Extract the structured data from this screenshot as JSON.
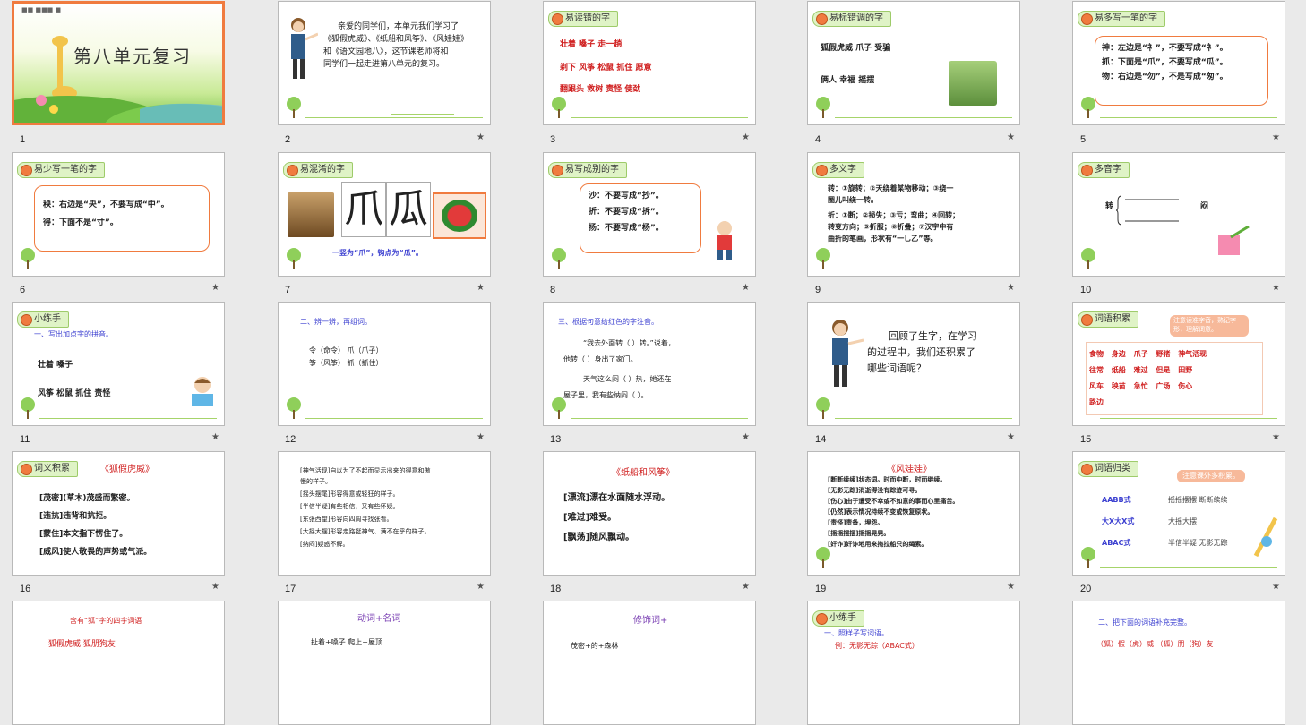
{
  "slides": [
    {
      "num": "1",
      "title": "第八单元复习",
      "header": "■■  ■■■  ■"
    },
    {
      "num": "2",
      "lines": [
        "亲爱的同学们，本单元我们学习了",
        "《狐假虎威》、《纸船和风筝》、《风娃娃》",
        "和《语文园地八》，这节课老师将和",
        "同学们一起走进第八单元的复习。"
      ]
    },
    {
      "num": "3",
      "tag": "易读错的字",
      "lines": [
        "壮着   嗓子   走一趟",
        "剃下   风筝   松鼠   抓住   愿意",
        "翻跟头   救树   责怪   使劲"
      ]
    },
    {
      "num": "4",
      "tag": "易标错调的字",
      "lines": [
        "狐假虎威   爪子   受骗",
        "俩人   幸福   摇摆"
      ]
    },
    {
      "num": "5",
      "tag": "易多写一笔的字",
      "lines": [
        "神：左边是“礻”，不要写成“衤”。",
        "抓：下面是“爪”，不要写成“瓜”。",
        "物：右边是“勿”，不是写成“匆”。"
      ]
    },
    {
      "num": "6",
      "tag": "易少写一笔的字",
      "lines": [
        "秧：右边是“央”，不要写成“中”。",
        "得：下面不是“寸”。"
      ]
    },
    {
      "num": "7",
      "tag": "易混淆的字",
      "chars": [
        "爪",
        "瓜"
      ],
      "caption": "一竖为“爪”，钩点为“瓜”。"
    },
    {
      "num": "8",
      "tag": "易写成别的字",
      "lines": [
        "沙：不要写成“抄”。",
        "折：不要写成“拆”。",
        "扬：不要写成“杨”。"
      ]
    },
    {
      "num": "9",
      "tag": "多义字",
      "lines": [
        "转：①旋转；②天绕着某物移动；③绕一",
        "圈儿叫绕一转。",
        "折：①断；②损失；③亏；弯曲；④回转；",
        "转变方向；⑤折服；⑥折叠；⑦汉字中有",
        "曲折的笔画，形状有“一乚乙”等。"
      ]
    },
    {
      "num": "10",
      "tag": "多音字",
      "lines": [
        "转",
        "闷"
      ]
    },
    {
      "num": "11",
      "tag": "小练手",
      "lines": [
        "一、写出加点字的拼音。",
        "壮着    嗓子",
        "风筝   松鼠   抓住   责怪"
      ]
    },
    {
      "num": "12",
      "lines": [
        "二、辨一辨，再组词。",
        "令（命令）   爪（爪子）",
        "筝（风筝）   抓（抓住）"
      ]
    },
    {
      "num": "13",
      "lines": [
        "三、根据句意给红色的字注音。",
        "“我去外面转（     ）转。”说着，",
        "他转（     ）身出了家门。",
        "天气这么闷（     ）热，她还在",
        "屋子里，我有些纳闷（     ）。"
      ]
    },
    {
      "num": "14",
      "lines": [
        "回顾了生字，在学习",
        "的过程中，我们还积累了",
        "哪些词语呢？"
      ]
    },
    {
      "num": "15",
      "tag": "词语积累",
      "note": "注意读准字音，熟记字形，理解词意。",
      "words": [
        [
          "食物",
          "身边",
          "爪子",
          "野猪",
          "神气活现"
        ],
        [
          "往常",
          "纸船",
          "难过",
          "但是",
          "田野"
        ],
        [
          "风车",
          "秧苗",
          "急忙",
          "广场",
          "伤心"
        ],
        [
          "路边"
        ]
      ]
    },
    {
      "num": "16",
      "tag": "词义积累",
      "heading": "《狐假虎威》",
      "lines": [
        "[茂密](草木)茂盛而繁密。",
        "[违抗]违背和抗拒。",
        "[蒙住]本文指下愣住了。",
        "[威风]使人敬畏的声势或气派。"
      ]
    },
    {
      "num": "17",
      "lines": [
        "[神气活现]自以为了不起而显示出来的得意和傲",
        "慢的样子。",
        "[摇头摆尾]形容得意或轻狂的样子。",
        "[半信半疑]有些相信，又有些怀疑。",
        "[东张西望]形容向四周寻找张看。",
        "[大摇大摆]形容走路挺神气、满不在乎的样子。",
        "[纳闷]疑惑不解。"
      ]
    },
    {
      "num": "18",
      "heading": "《纸船和风筝》",
      "lines": [
        "[漂流]漂在水面随水浮动。",
        "[难过]难受。",
        "[飘荡]随风飘动。"
      ]
    },
    {
      "num": "19",
      "heading": "《风娃娃》",
      "lines": [
        "[断断续续]状态词。时而中断，时而继续。",
        "[无影无踪]消逝得没有踪迹可寻。",
        "[伤心]由于遭受不幸或不如意的事而心里痛苦。",
        "[仍然]表示情况持续不变或恢复原状。",
        "[责怪]责备，埋怨。",
        "[摇摇摆摆]摇摇晃晃。",
        "[奸诈]奸诈地用来拖拉船只的绳索。"
      ]
    },
    {
      "num": "20",
      "tag": "词语归类",
      "note": "注意课外多积累。",
      "rows": [
        [
          "AABB式",
          "摇摇摆摆  断断续续"
        ],
        [
          "大X大X式",
          "大摇大摆"
        ],
        [
          "ABAC式",
          "半信半疑  无影无踪"
        ]
      ]
    },
    {
      "num": "21",
      "heading": "含有“狐”字的四字词语",
      "lines": [
        "狐假虎威    狐朋狗友"
      ]
    },
    {
      "num": "22",
      "heading": "动词+名词",
      "lines": [
        "扯着+嗓子    爬上+屋顶"
      ]
    },
    {
      "num": "23",
      "heading": "修饰词+",
      "lines": [
        "茂密+的+森林"
      ]
    },
    {
      "num": "24",
      "tag": "小练手",
      "lines": [
        "一、照样子写词语。",
        "例：无影无踪（ABAC式）"
      ]
    },
    {
      "num": "25",
      "lines": [
        "二、把下面的词语补充完整。",
        "（狐）假（虎）威     （狐）朋（狗）友"
      ]
    }
  ],
  "colors": {
    "accent": "#f07b3f",
    "tag_bg": "#dff3c6",
    "red": "#d02020",
    "blue": "#3b3fd0"
  }
}
